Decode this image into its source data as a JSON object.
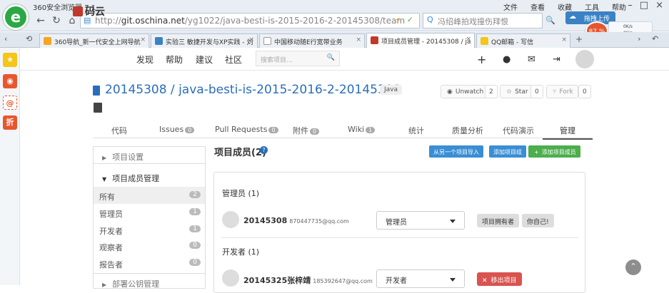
{
  "browser": {
    "window_title": "360安全浏览器 7.1",
    "menu": [
      "文件",
      "查看",
      "收藏",
      "工具",
      "帮助"
    ],
    "url_prefix": "http://",
    "url_host": "git.oschina.net",
    "url_path": "/yg1022/java-besti-is-2015-2016-2-20145308/team",
    "search_text": "冯绍峰拍戏撞伤拜恨",
    "upload_label": "拖拽上传",
    "speed_ball": "87 %",
    "speed_up": "0K/s",
    "speed_down": "0K/s"
  },
  "tabs": [
    {
      "label": "360导航_新一代安全上网导航",
      "color": "#f5a623"
    },
    {
      "label": "实验三 敏捷开发与XP实践 - 刘",
      "color": "#3b82c4"
    },
    {
      "label": "中国移动随E行宽带业务",
      "color": "#bbbbbb"
    },
    {
      "label": "项目成员管理 - 20145308 / ja",
      "color": "#c0392b"
    },
    {
      "label": "QQ邮箱 - 写信",
      "color": "#f5c518"
    }
  ],
  "site_nav": {
    "logo": "码云",
    "links": [
      "发现",
      "帮助",
      "建议",
      "社区"
    ],
    "search_placeholder": "搜索项目..."
  },
  "repo": {
    "title": "20145308 / java-besti-is-2015-2016-2-20145308",
    "language": "Java",
    "watch_label": "Unwatch",
    "watch_count": "2",
    "star_label": "Star",
    "star_count": "0",
    "fork_label": "Fork",
    "fork_count": "0"
  },
  "repo_tabs": [
    {
      "label": "代码",
      "count": ""
    },
    {
      "label": "Issues",
      "count": "0"
    },
    {
      "label": "Pull Requests",
      "count": "0"
    },
    {
      "label": "附件",
      "count": "0"
    },
    {
      "label": "Wiki",
      "count": "1"
    },
    {
      "label": "统计",
      "count": ""
    },
    {
      "label": "质量分析",
      "count": ""
    },
    {
      "label": "代码演示",
      "count": ""
    },
    {
      "label": "管理",
      "count": ""
    }
  ],
  "left_panel": {
    "settings": "项目设置",
    "member_mgmt": "项目成员管理",
    "items": [
      {
        "label": "所有",
        "count": "2"
      },
      {
        "label": "管理员",
        "count": "1"
      },
      {
        "label": "开发者",
        "count": "1"
      },
      {
        "label": "观察者",
        "count": "0"
      },
      {
        "label": "报告者",
        "count": "0"
      }
    ],
    "dept_public": "部署公钥管理"
  },
  "members": {
    "title": "项目成员(2)",
    "import_btn": "从另一个项目导入",
    "group_btn": "添加项目组",
    "add_btn": "添加项目成员",
    "groups": [
      {
        "title": "管理员 (1)",
        "name": "20145308",
        "email": "870447735@qq.com",
        "role": "管理员",
        "tag1": "项目拥有者",
        "tag2": "你自己!"
      },
      {
        "title": "开发者 (1)",
        "name": "20145325张梓靖",
        "email": "185392647@qq.com",
        "role": "开发者",
        "remove": "移出项目"
      }
    ]
  },
  "colors": {
    "accent_blue": "#2a6ebb",
    "btn_blue": "#3a8ed4",
    "btn_green": "#4cae4c",
    "btn_red": "#d9534f"
  }
}
